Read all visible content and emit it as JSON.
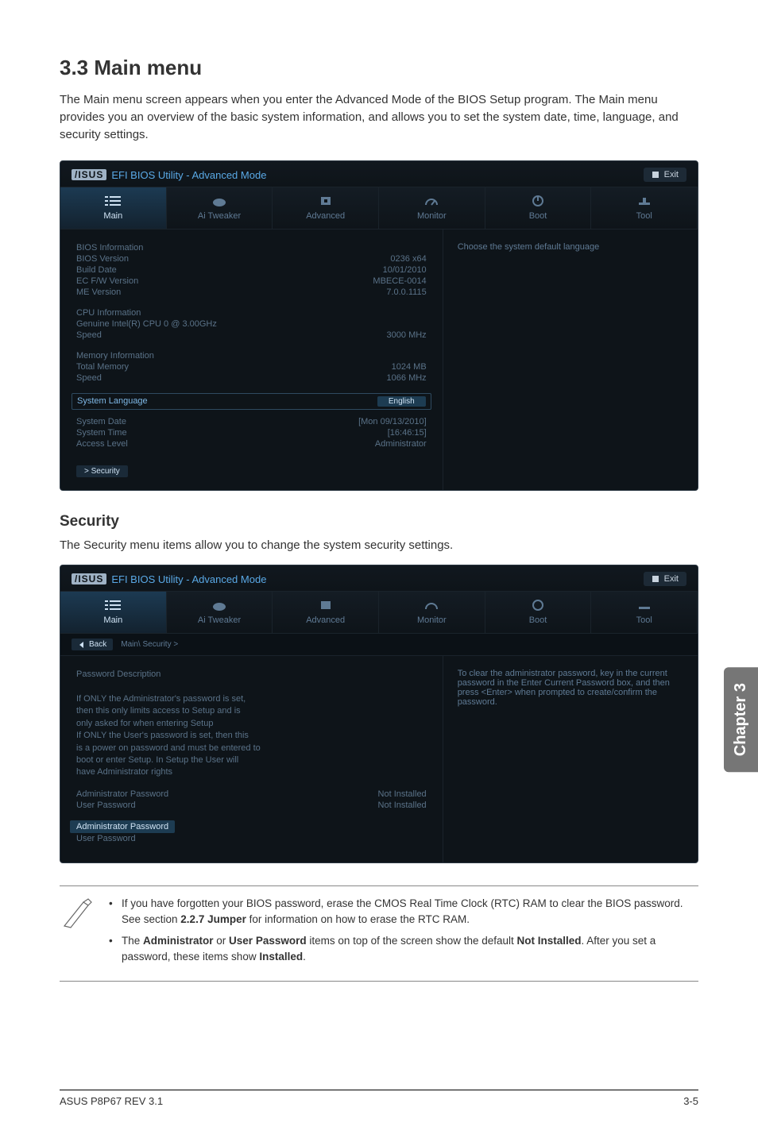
{
  "heading": "3.3     Main menu",
  "intro": "The Main menu screen appears when you enter the Advanced Mode of the BIOS Setup program. The Main menu provides you an overview of the basic system information, and allows you to set the system date, time, language, and security settings.",
  "bios": {
    "logo": "/ISUS",
    "title": "EFI BIOS Utility - Advanced Mode",
    "exit": "Exit",
    "tabs": {
      "main": "Main",
      "ai": "Ai  Tweaker",
      "advanced": "Advanced",
      "monitor": "Monitor",
      "boot": "Boot",
      "tool": "Tool"
    },
    "right_hint_main": "Choose the system default language",
    "info": {
      "bios_information": "BIOS Information",
      "bios_version_l": "BIOS Version",
      "bios_version_v": "0236 x64",
      "build_date_l": "Build Date",
      "build_date_v": "10/01/2010",
      "ec_l": "EC F/W Version",
      "ec_v": "MBECE-0014",
      "me_l": "ME Version",
      "me_v": "7.0.0.1115",
      "cpu_information": "CPU Information",
      "cpu_name": "Genuine Intel(R) CPU 0 @ 3.00GHz",
      "cpu_speed_l": "Speed",
      "cpu_speed_v": "3000 MHz",
      "mem_information": "Memory Information",
      "total_mem_l": "Total Memory",
      "total_mem_v": "1024 MB",
      "mem_speed_l": "Speed",
      "mem_speed_v": "1066 MHz",
      "sys_lang_l": "System Language",
      "sys_lang_v": "English",
      "sys_date_l": "System Date",
      "sys_date_v": "[Mon 09/13/2010]",
      "sys_time_l": "System Time",
      "sys_time_v": "[16:46:15]",
      "access_l": "Access Level",
      "access_v": "Administrator",
      "security_submenu": "> Security"
    }
  },
  "security": {
    "heading": "Security",
    "intro": "The Security menu items allow you to change the system security settings.",
    "breadcrumb_back": "Back",
    "breadcrumb_path": "Main\\ Security >",
    "desc_title": "Password Description",
    "desc_lines": [
      "If ONLY the Administrator's password is set,",
      "then this only limits access to Setup and is",
      "only asked for when entering Setup",
      "If ONLY the User's password is set, then this",
      "is a power on password and must be entered to",
      "boot or enter Setup. In Setup the User will",
      "have Administrator rights"
    ],
    "admin_pwd_l": "Administrator Password",
    "admin_pwd_v": "Not Installed",
    "user_pwd_l": "User Password",
    "user_pwd_v": "Not Installed",
    "admin_pwd_hl": "Administrator Password",
    "user_pwd_plain": "User Password",
    "right_hint": "To clear the administrator password, key in the current password in the Enter Current Password box, and then press <Enter> when prompted to create/confirm the password."
  },
  "notes": {
    "n1a": "If you have forgotten your BIOS password, erase the CMOS Real Time Clock (RTC) RAM to clear the BIOS password. See section ",
    "n1b": "2.2.7 Jumper",
    "n1c": " for information on how to erase the RTC RAM.",
    "n2a": "The ",
    "n2b": "Administrator",
    "n2c": " or ",
    "n2d": "User Password",
    "n2e": " items on top of the screen show the default ",
    "n2f": "Not Installed",
    "n2g": ". After you set a password, these items show ",
    "n2h": "Installed",
    "n2i": "."
  },
  "side_tab": "Chapter 3",
  "footer_left": "ASUS P8P67 REV 3.1",
  "footer_right": "3-5"
}
